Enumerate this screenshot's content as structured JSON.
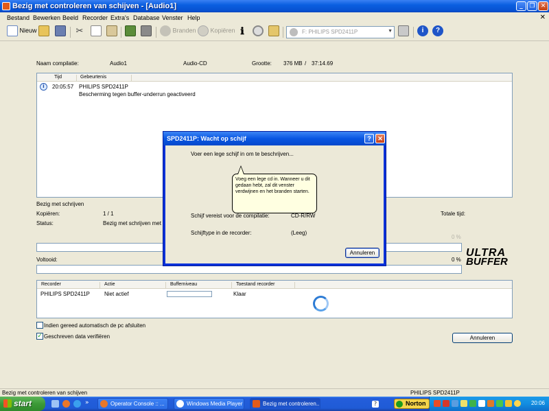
{
  "window": {
    "title": "Bezig met controleren van schijven - [Audio1]"
  },
  "menu": [
    "Bestand",
    "Bewerken",
    "Beeld",
    "Recorder",
    "Extra's",
    "Database",
    "Venster",
    "Help"
  ],
  "toolbar": {
    "new_label": "Nieuw",
    "burn_label": "Branden",
    "copy_label": "Kopiëren",
    "drive": "F: PHILIPS SPD2411P"
  },
  "compilation": {
    "name_label": "Naam compilatie:",
    "name_value": "Audio1",
    "type_value": "Audio-CD",
    "size_label": "Grootte:",
    "size_mb": "376 MB",
    "size_sep": "/",
    "size_time": "37:14.69"
  },
  "log": {
    "columns": [
      "Tijd",
      "Gebeurtenis"
    ],
    "rows": [
      {
        "time": "20:05:57",
        "event": "PHILIPS SPD2411P",
        "detail": "Bescherming tegen buffer-underrun geactiveerd"
      }
    ]
  },
  "progress": {
    "section_label": "Bezig met schrijven",
    "copies_label": "Kopiëren:",
    "copies_value": "1 / 1",
    "status_label": "Status:",
    "status_value": "Bezig met schrijven met 48",
    "total_time_label": "Totale tijd:",
    "track_percent": "0 %",
    "done_label": "Voltooid:",
    "done_percent": "0 %",
    "track_fraction": 0,
    "done_fraction": 0
  },
  "brand": {
    "logo_line1": "ULTRA",
    "logo_line2": "BUFFER"
  },
  "recorders": {
    "columns": [
      "Recorder",
      "Actie",
      "Bufferniveau",
      "Toestand recorder"
    ],
    "rows": [
      {
        "recorder": "PHILIPS SPD2411P",
        "action": "Niet actief",
        "buffer_fraction": 0,
        "state": "Klaar"
      }
    ]
  },
  "options": {
    "shutdown_label": "Indien gereed automatisch de pc afsluiten",
    "shutdown_checked": false,
    "verify_label": "Geschreven data verifiëren",
    "verify_checked": true
  },
  "cancel_label": "Annuleren",
  "dialog": {
    "title": "SPD2411P: Wacht op schijf",
    "message": "Voer een lege schijf in om te beschrijven...",
    "balloon": "Voeg een lege cd in. Wanneer u dit gedaan hebt, zal dit venster verdwijnen en het branden starten.",
    "req_label": "Schijf vereist voor de compilatie:",
    "req_value": "CD-R/RW",
    "type_label": "Schijftype in de recorder:",
    "type_value": "(Leeg)",
    "cancel_label": "Annuleren"
  },
  "statusbar": {
    "left": "Bezig met controleren van schijven",
    "right": "PHILIPS  SPD2411P"
  },
  "taskbar": {
    "start": "start",
    "tasks": [
      "Operator Console :: ...",
      "Windows Media Player",
      "Bezig met controleren..."
    ],
    "norton": "Norton",
    "clock": "20:06"
  },
  "icons": [
    "new-icon",
    "open-icon",
    "save-icon",
    "cut-icon",
    "copy-icon",
    "paste-icon",
    "wizard-icon",
    "tools-icon",
    "burn-icon",
    "copy-disc-icon",
    "info-icon",
    "disc-icon",
    "folder-icon",
    "drive-icon",
    "eject-icon",
    "about-icon",
    "help-icon",
    "busy-cursor-icon"
  ]
}
